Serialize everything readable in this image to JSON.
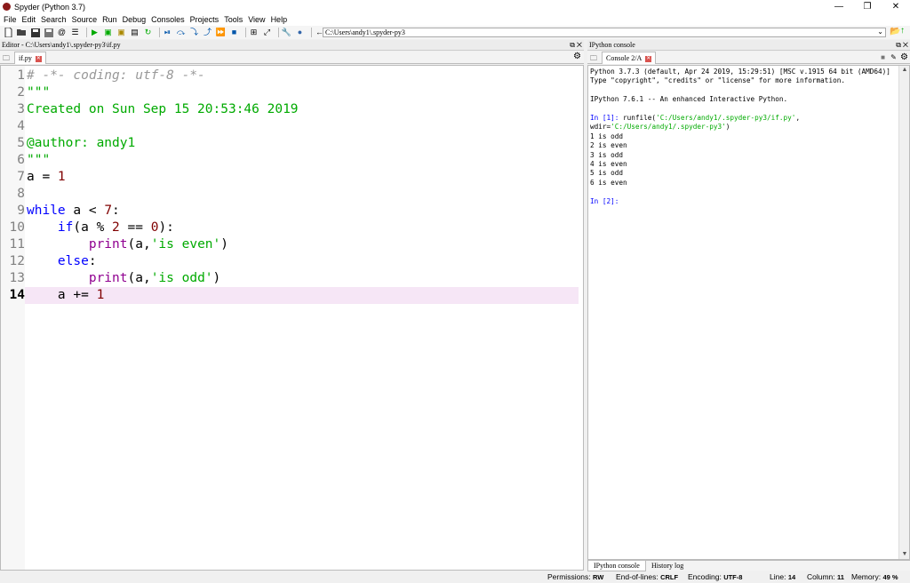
{
  "window": {
    "title": "Spyder (Python 3.7)",
    "min": "—",
    "restore": "❐",
    "close": "✕"
  },
  "menu": [
    "File",
    "Edit",
    "Search",
    "Source",
    "Run",
    "Debug",
    "Consoles",
    "Projects",
    "Tools",
    "View",
    "Help"
  ],
  "toolbar": {
    "path": "C:\\Users\\andy1\\.spyder-py3"
  },
  "editor": {
    "pane_title": "Editor - C:\\Users\\andy1\\.spyder-py3\\if.py",
    "tab": "if.py",
    "current_line": 14,
    "lines": [
      {
        "n": "1",
        "parts": [
          [
            "comment",
            "# -*- coding: utf-8 -*-"
          ]
        ]
      },
      {
        "n": "2",
        "parts": [
          [
            "string",
            "\"\"\""
          ]
        ]
      },
      {
        "n": "3",
        "parts": [
          [
            "string",
            "Created on Sun Sep 15 20:53:46 2019"
          ]
        ]
      },
      {
        "n": "4",
        "parts": [
          [
            "plain",
            ""
          ]
        ]
      },
      {
        "n": "5",
        "parts": [
          [
            "string",
            "@author: andy1"
          ]
        ]
      },
      {
        "n": "6",
        "parts": [
          [
            "string",
            "\"\"\""
          ]
        ]
      },
      {
        "n": "7",
        "parts": [
          [
            "plain",
            "a = "
          ],
          [
            "num",
            "1"
          ]
        ]
      },
      {
        "n": "8",
        "parts": [
          [
            "plain",
            ""
          ]
        ]
      },
      {
        "n": "9",
        "parts": [
          [
            "kw",
            "while"
          ],
          [
            "plain",
            " a < "
          ],
          [
            "num",
            "7"
          ],
          [
            "plain",
            ":"
          ]
        ]
      },
      {
        "n": "10",
        "parts": [
          [
            "plain",
            "    "
          ],
          [
            "kw",
            "if"
          ],
          [
            "plain",
            "(a % "
          ],
          [
            "num",
            "2"
          ],
          [
            "plain",
            " == "
          ],
          [
            "num",
            "0"
          ],
          [
            "plain",
            "):"
          ]
        ]
      },
      {
        "n": "11",
        "parts": [
          [
            "plain",
            "        "
          ],
          [
            "builtin",
            "print"
          ],
          [
            "plain",
            "(a,"
          ],
          [
            "string",
            "'is even'"
          ],
          [
            "plain",
            ")"
          ]
        ]
      },
      {
        "n": "12",
        "parts": [
          [
            "plain",
            "    "
          ],
          [
            "kw",
            "else"
          ],
          [
            "plain",
            ":"
          ]
        ]
      },
      {
        "n": "13",
        "parts": [
          [
            "plain",
            "        "
          ],
          [
            "builtin",
            "print"
          ],
          [
            "plain",
            "(a,"
          ],
          [
            "string",
            "'is odd'"
          ],
          [
            "plain",
            ")"
          ]
        ]
      },
      {
        "n": "14",
        "parts": [
          [
            "plain",
            "    a += "
          ],
          [
            "num",
            "1"
          ]
        ]
      }
    ]
  },
  "console": {
    "pane_title": "IPython console",
    "tab": "Console 2/A",
    "lines": [
      [
        [
          "plain",
          "Python 3.7.3 (default, Apr 24 2019, 15:29:51) [MSC v.1915 64 bit (AMD64)]"
        ]
      ],
      [
        [
          "plain",
          "Type \"copyright\", \"credits\" or \"license\" for more information."
        ]
      ],
      [
        [
          "plain",
          ""
        ]
      ],
      [
        [
          "plain",
          "IPython 7.6.1 -- An enhanced Interactive Python."
        ]
      ],
      [
        [
          "plain",
          ""
        ]
      ],
      [
        [
          "prompt",
          "In [1]: "
        ],
        [
          "plain",
          "runfile("
        ],
        [
          "str",
          "'C:/Users/andy1/.spyder-py3/if.py'"
        ],
        [
          "plain",
          ", wdir="
        ],
        [
          "str",
          "'C:/Users/andy1/.spyder-py3'"
        ],
        [
          "plain",
          ")"
        ]
      ],
      [
        [
          "plain",
          "1 is odd"
        ]
      ],
      [
        [
          "plain",
          "2 is even"
        ]
      ],
      [
        [
          "plain",
          "3 is odd"
        ]
      ],
      [
        [
          "plain",
          "4 is even"
        ]
      ],
      [
        [
          "plain",
          "5 is odd"
        ]
      ],
      [
        [
          "plain",
          "6 is even"
        ]
      ],
      [
        [
          "plain",
          ""
        ]
      ],
      [
        [
          "prompt",
          "In [2]: "
        ]
      ]
    ],
    "bottom_tabs": [
      "IPython console",
      "History log"
    ]
  },
  "status": {
    "permissions_label": "Permissions:",
    "permissions": "RW",
    "eol_label": "End-of-lines:",
    "eol": "CRLF",
    "encoding_label": "Encoding:",
    "encoding": "UTF-8",
    "line_label": "Line:",
    "line": "14",
    "column_label": "Column:",
    "column": "11",
    "memory_label": "Memory:",
    "memory": "49 %"
  }
}
